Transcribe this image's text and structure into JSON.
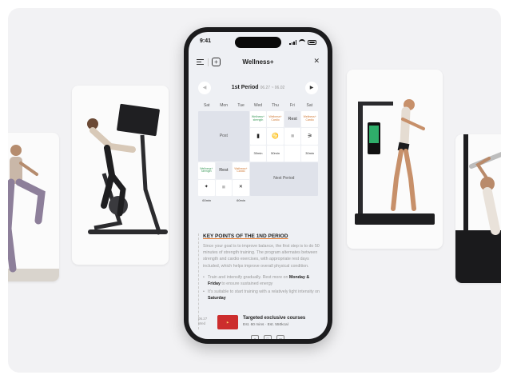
{
  "status": {
    "time": "9:41"
  },
  "nav": {
    "title": "Wellness+",
    "close": "✕",
    "add": "+"
  },
  "period": {
    "label": "1st Period",
    "range": "06.27 ~ 06.02",
    "prev": "◀",
    "next": "▶"
  },
  "days": [
    "Sat",
    "Mon",
    "Tue",
    "Wed",
    "Thu",
    "Fri",
    "Sat"
  ],
  "schedule": {
    "post": "Post",
    "next_period": "Next Period",
    "rest": "Rest",
    "tag_strength": "Wellness+ strength",
    "tag_cardio": "Wellness+ Cardio",
    "dur_30": "30min",
    "dur_50": "50min",
    "dur_60": "60min"
  },
  "keypoints": {
    "title": "KEY POINTS OF THE 1ND PERIOD",
    "paragraph": "Since your goal is to improve balance, the first step is to do 50 minutes of strength training. The program alternates between strength and cardio exercises, with appropriate rest days included, which helps improve overall physical condition.",
    "b1_pre": "Train and intensify gradually. Rest more on",
    "b1_bold": "Monday & Friday",
    "b1_post": "to ensure sustained energy",
    "b2_pre": "It's suitable to start training with a relatively light intensity on",
    "b2_bold": "Saturday"
  },
  "course": {
    "date": "06.27",
    "day": "Wed",
    "title": "Targeted exclusive courses",
    "meta": "Est. 60 mins · Est. 550kcal"
  },
  "colors": {
    "accent": "#e47a2f",
    "green": "#3b9a5a",
    "thumb": "#cc2d2d"
  }
}
